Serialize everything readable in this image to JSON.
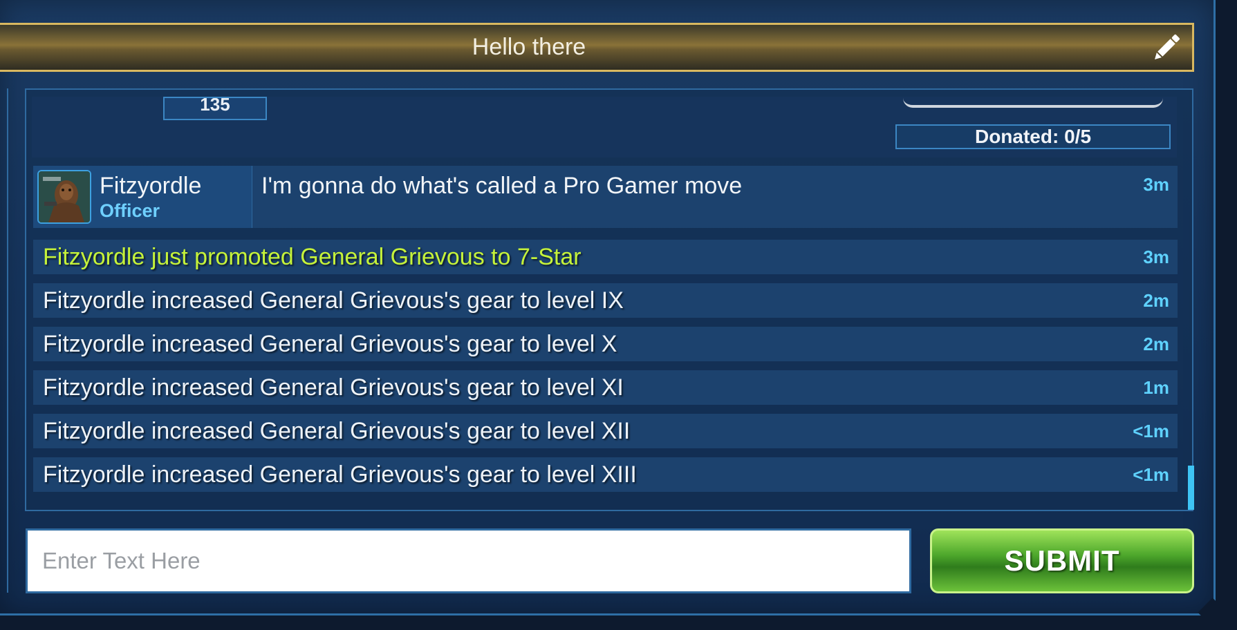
{
  "header": {
    "title": "Hello there",
    "edit_icon": "pencil-icon"
  },
  "donation": {
    "count_text": "135",
    "donated_label": "Donated: 0/5"
  },
  "message": {
    "user": "Fitzyordle",
    "role": "Officer",
    "text": "I'm gonna do what's called a Pro Gamer move",
    "time": "3m",
    "avatar_icon": "chewbacca-avatar"
  },
  "log": [
    {
      "text": "Fitzyordle just promoted General Grievous to 7-Star",
      "time": "3m",
      "highlight": true
    },
    {
      "text": "Fitzyordle increased General Grievous's gear to level IX",
      "time": "2m"
    },
    {
      "text": "Fitzyordle increased General Grievous's gear to level X",
      "time": "2m"
    },
    {
      "text": "Fitzyordle increased General Grievous's gear to level XI",
      "time": "1m"
    },
    {
      "text": "Fitzyordle increased General Grievous's gear to level XII",
      "time": "<1m"
    },
    {
      "text": "Fitzyordle increased General Grievous's gear to level XIII",
      "time": "<1m"
    }
  ],
  "input": {
    "placeholder": "Enter Text Here",
    "value": ""
  },
  "submit": {
    "label": "SUBMIT"
  },
  "colors": {
    "accent": "#5fd2ff",
    "promo": "#c5f23a",
    "submit": "#4ea82c",
    "header_border": "#d9b860"
  }
}
